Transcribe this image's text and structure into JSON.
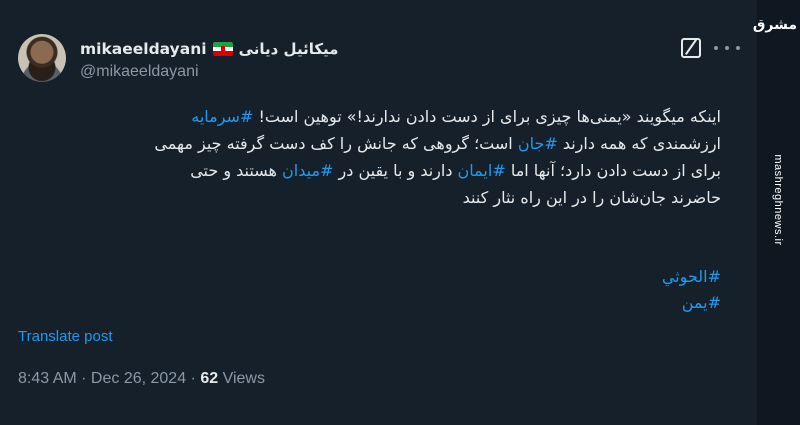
{
  "author": {
    "display_name": "mikaeeldayani",
    "persian_name": "میکائیل دیانی",
    "handle": "@mikaeeldayani"
  },
  "body": {
    "line1_a": "اینکه میگویند «یمنی‌ها چیزی برای از دست دادن ندارند!» توهین است! ",
    "line1_tag": "#سرمایه",
    "line2_a": "ارزشمندی که همه دارند ",
    "line2_tag": "#جان",
    "line2_b": " است؛ گروهی که جانش را کف دست گرفته چیز مهمی",
    "line3_a": "برای از دست دادن دارد؛ آنها اما ",
    "line3_tag1": "#ایمان",
    "line3_b": " دارند و با یقین در ",
    "line3_tag2": "#میدان",
    "line3_c": " هستند و حتی",
    "line4": "حاضرند جان‌شان را در این راه نثار کنند"
  },
  "hashtags": [
    "#الحوثي",
    "#یمن"
  ],
  "translate_label": "Translate post",
  "meta": {
    "time": "8:43 AM",
    "separator": " · ",
    "date": "Dec 26, 2024",
    "views_count": "62",
    "views_label": " Views"
  },
  "watermark": {
    "logo_text": "مشرق",
    "url": "mashreghnews.ir"
  },
  "colors": {
    "background": "#15202b",
    "text": "#e7e9ea",
    "secondary": "#8b98a5",
    "link": "#1d9bf0"
  },
  "icons": [
    "grok-icon",
    "more-icon"
  ]
}
